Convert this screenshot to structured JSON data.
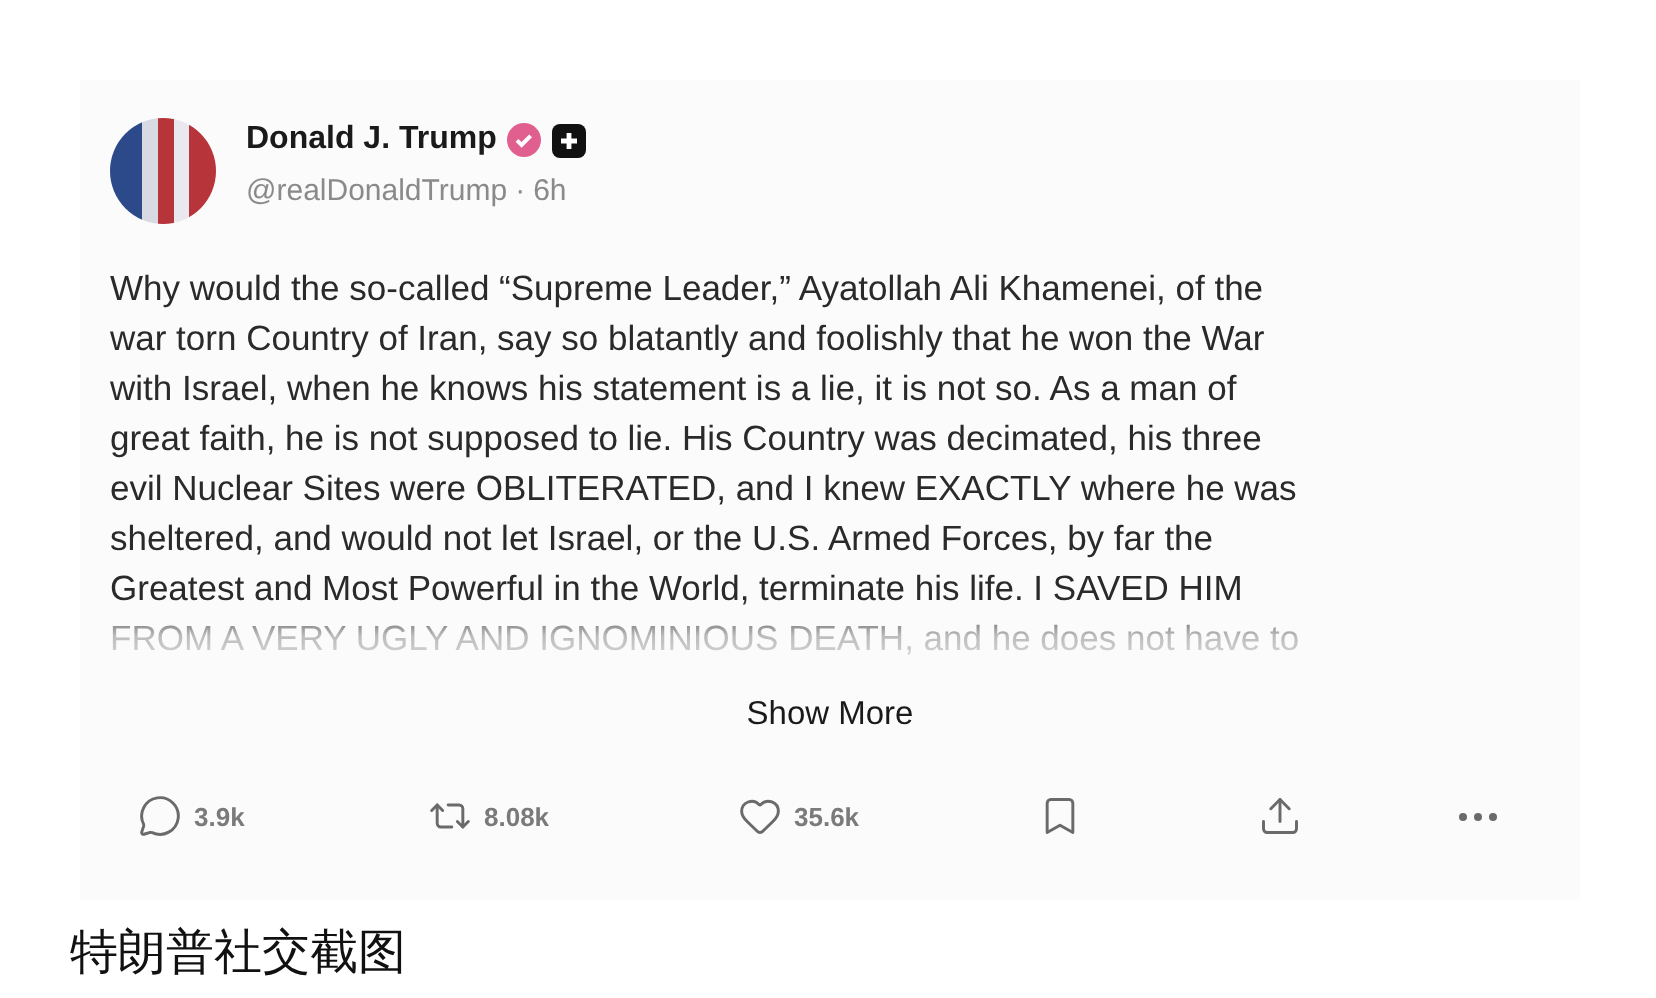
{
  "post": {
    "author": {
      "name": "Donald J. Trump",
      "handle": "@realDonaldTrump",
      "separator": "·",
      "time": "6h"
    },
    "body_lines": [
      "Why would the so-called “Supreme Leader,” Ayatollah Ali Khamenei, of the",
      "war torn Country of Iran, say so blatantly and foolishly that he won the War",
      "with Israel, when he knows his statement is a lie, it is not so. As a man of",
      "great faith, he is not supposed to lie. His Country was decimated, his three",
      "evil Nuclear Sites were OBLITERATED, and I knew EXACTLY where he was",
      "sheltered, and would not let Israel, or the U.S. Armed Forces, by far the",
      "Greatest and Most Powerful in the World, terminate his life. I SAVED HIM",
      "FROM A VERY UGLY AND IGNOMINIOUS DEATH, and he does not have to"
    ],
    "show_more": "Show More",
    "actions": [
      {
        "kind": "reply",
        "count": "3.9k"
      },
      {
        "kind": "repost",
        "count": "8.08k"
      },
      {
        "kind": "like",
        "count": "35.6k"
      },
      {
        "kind": "bookmark"
      },
      {
        "kind": "share"
      },
      {
        "kind": "more"
      }
    ]
  },
  "caption": "特朗普社交截图"
}
